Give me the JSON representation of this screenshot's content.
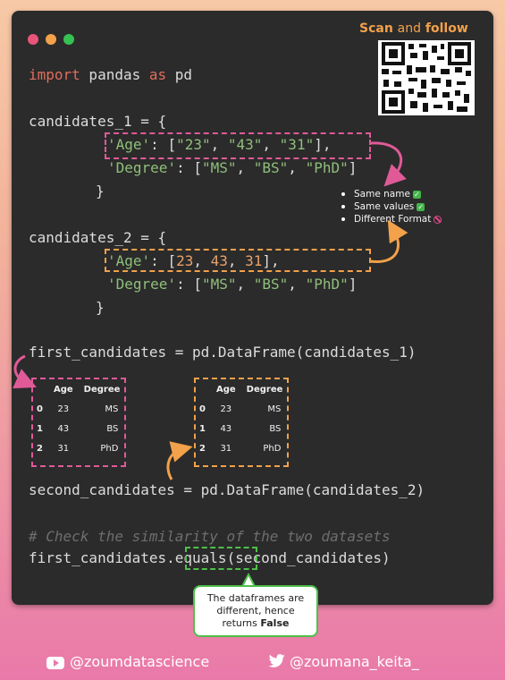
{
  "window": {
    "dots": [
      "#e9557a",
      "#f3a14a",
      "#35c252"
    ],
    "banner": {
      "scan": "Scan",
      "and": "and",
      "follow": "follow"
    }
  },
  "code": {
    "import": {
      "kw1": "import",
      "mod": " pandas ",
      "kw2": "as",
      "alias": " pd"
    },
    "cand1_open": "candidates_1 = {",
    "cand1_age": {
      "key": "'Age'",
      "rest1": ": [",
      "v1": "\"23\"",
      "c1": ", ",
      "v2": "\"43\"",
      "c2": ", ",
      "v3": "\"31\"",
      "end": "],"
    },
    "cand1_deg": {
      "key": "'Degree'",
      "rest1": ": [",
      "v1": "\"MS\"",
      "c1": ", ",
      "v2": "\"BS\"",
      "c2": ", ",
      "v3": "\"PhD\"",
      "end": "]"
    },
    "close1": "}",
    "cand2_open": "candidates_2 = {",
    "cand2_age": {
      "key": "'Age'",
      "rest1": ": [",
      "v1": "23",
      "c1": ", ",
      "v2": "43",
      "c2": ", ",
      "v3": "31",
      "end": "],"
    },
    "cand2_deg": {
      "key": "'Degree'",
      "rest1": ": [",
      "v1": "\"MS\"",
      "c1": ", ",
      "v2": "\"BS\"",
      "c2": ", ",
      "v3": "\"PhD\"",
      "end": "]"
    },
    "close2": "}",
    "first_df": "first_candidates = pd.DataFrame(candidates_1)",
    "second_df": "second_candidates = pd.DataFrame(candidates_2)",
    "comment": "# Check the similarity of the two datasets",
    "equals": {
      "pre": "first_candidates",
      "method": ".equals",
      "post": "(second_candidates)"
    }
  },
  "notes": [
    "Same name",
    "Same values",
    "Different Format"
  ],
  "tables": {
    "headers": [
      "Age",
      "Degree"
    ],
    "rows": [
      {
        "idx": "0",
        "age": "23",
        "deg": "MS"
      },
      {
        "idx": "1",
        "age": "43",
        "deg": "BS"
      },
      {
        "idx": "2",
        "age": "31",
        "deg": "PhD"
      }
    ]
  },
  "callout": {
    "line1": "The dataframes are",
    "line2": "different, hence",
    "line3a": "returns ",
    "line3b": "False"
  },
  "footer": {
    "youtube": "@zoumdatascience",
    "twitter": "@zoumana_keita_"
  },
  "colors": {
    "pink": "#e05a98",
    "orange": "#f3a14a",
    "green": "#4fbf4a",
    "window_bg": "#2b2b2b"
  }
}
